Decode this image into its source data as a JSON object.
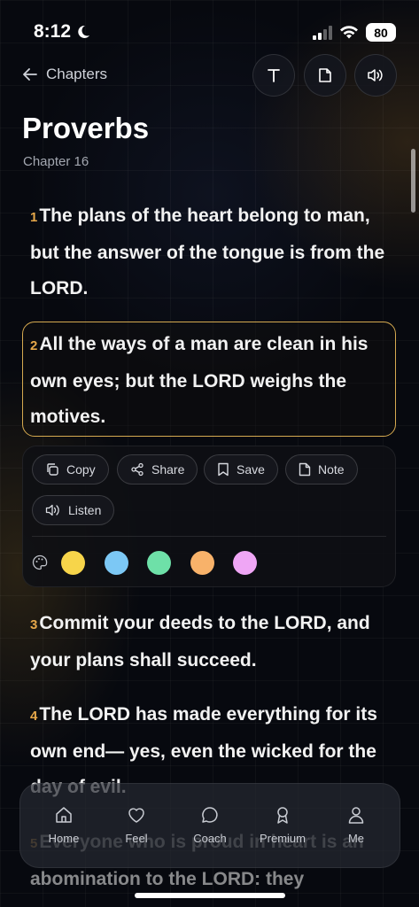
{
  "status": {
    "time": "8:12",
    "battery": "80"
  },
  "nav": {
    "back_label": "Chapters"
  },
  "book": {
    "title": "Proverbs",
    "chapter": "Chapter 16"
  },
  "verses": [
    {
      "num": "1",
      "text": "The plans of the heart belong to man, but the answer of the tongue is from the LORD."
    },
    {
      "num": "2",
      "text": "All the ways of a man are clean in his own eyes; but the LORD weighs the motives."
    },
    {
      "num": "3",
      "text": "Commit your deeds to the LORD, and your plans shall succeed."
    },
    {
      "num": "4",
      "text": "The LORD has made everything for its own end— yes, even the wicked for the day of evil."
    },
    {
      "num": "5",
      "text": "Everyone who is proud in heart is an abomination to the LORD: they"
    }
  ],
  "actions": {
    "copy": "Copy",
    "share": "Share",
    "save": "Save",
    "note": "Note",
    "listen": "Listen"
  },
  "highlight_colors": [
    "#f7d54a",
    "#7cc8f5",
    "#6ee0a8",
    "#f8b26a",
    "#efa6f5"
  ],
  "tabs": {
    "home": "Home",
    "feel": "Feel",
    "coach": "Coach",
    "premium": "Premium",
    "me": "Me"
  },
  "colors": {
    "accent": "#e6a84a",
    "selected_border": "#d6aa50"
  }
}
